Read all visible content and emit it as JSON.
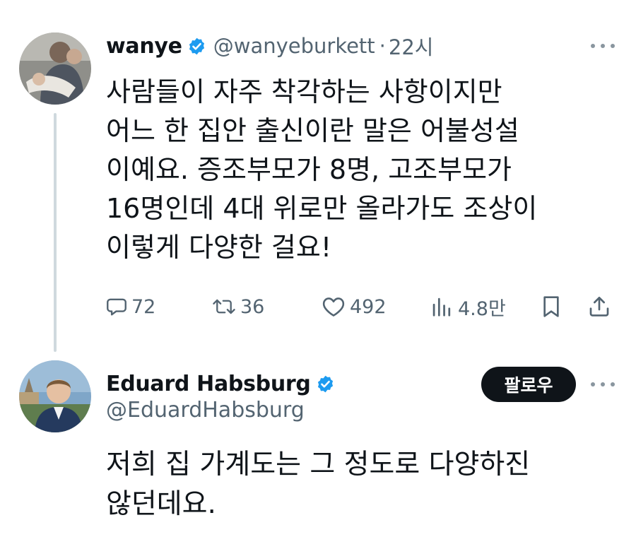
{
  "tweet1": {
    "display_name": "wanye",
    "handle": "@wanyeburkett",
    "separator": "·",
    "time": "22시",
    "text_lines": [
      "사람들이 자주 착각하는 사항이지만",
      "어느 한 집안 출신이란 말은 어불성설",
      "이예요. 증조부모가 8명, 고조부모가",
      "16명인데 4대 위로만 올라가도 조상이",
      "이렇게 다양한 걸요!"
    ],
    "actions": {
      "reply_count": "72",
      "retweet_count": "36",
      "like_count": "492",
      "view_count": "4.8만"
    }
  },
  "tweet2": {
    "display_name": "Eduard Habsburg",
    "handle": "@EduardHabsburg",
    "follow_label": "팔로우",
    "text_lines": [
      "저희 집 가계도는 그 정도로 다양하진",
      "않던데요."
    ]
  },
  "colors": {
    "text": "#0f1419",
    "secondary": "#536471",
    "verified": "#1d9bf0",
    "thread_line": "#cfd9de",
    "button_bg": "#0f1419"
  },
  "icons": [
    "verified-badge-icon",
    "more-icon",
    "reply-icon",
    "retweet-icon",
    "like-icon",
    "views-icon",
    "bookmark-icon",
    "share-icon"
  ]
}
